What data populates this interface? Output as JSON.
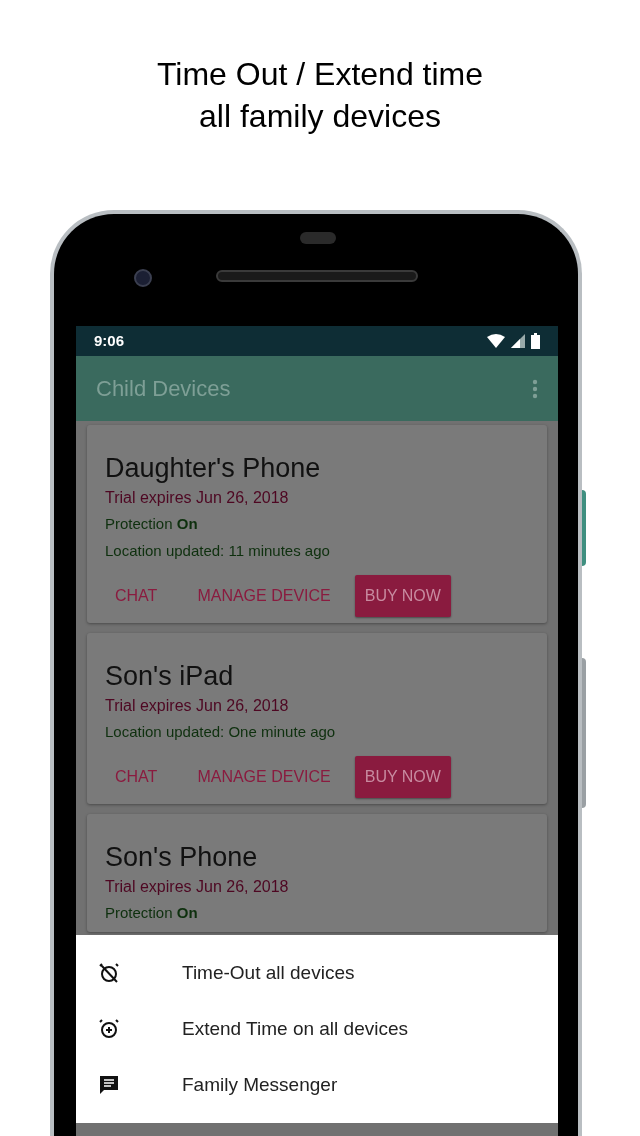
{
  "headline": [
    "Time Out / Extend time",
    "all family devices"
  ],
  "status_bar": {
    "time": "9:06"
  },
  "app_bar": {
    "title": "Child Devices"
  },
  "devices": [
    {
      "name": "Daughter's Phone",
      "trial": "Trial expires Jun 26, 2018",
      "protection": "Protection **On**",
      "location": "Location updated: 11 minutes ago",
      "actions": [
        {
          "label": "CHAT",
          "kind": "text"
        },
        {
          "label": "MANAGE DEVICE",
          "kind": "text"
        },
        {
          "label": "BUY NOW",
          "kind": "filled"
        }
      ]
    },
    {
      "name": "Son's iPad",
      "trial": "Trial expires Jun 26, 2018",
      "location": "Location updated: One minute ago",
      "actions": [
        {
          "label": "CHAT",
          "kind": "text"
        },
        {
          "label": "MANAGE DEVICE",
          "kind": "text"
        },
        {
          "label": "BUY NOW",
          "kind": "filled"
        }
      ]
    },
    {
      "name": "Son's Phone",
      "trial": "Trial expires Jun 26, 2018",
      "protection": "Protection **On**"
    }
  ],
  "bottom_sheet": {
    "items": [
      {
        "label": "Time-Out all devices",
        "kind": "timeout"
      },
      {
        "label": "Extend Time on all devices",
        "kind": "extend"
      },
      {
        "label": "Family Messenger",
        "kind": "message"
      }
    ]
  }
}
